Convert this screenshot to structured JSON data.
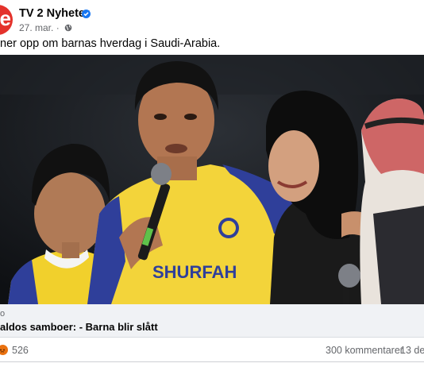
{
  "post": {
    "page_name": "TV 2 Nyheter",
    "date": "27. mar.",
    "audience_icon": "globe-icon",
    "caption": "ner opp om barnas hverdag i Saudi-Arabia.",
    "image": {
      "jersey_text": "SHURFAH"
    },
    "link": {
      "domain": "o",
      "title": "aldos samboer: - Barna blir slått"
    },
    "reactions": {
      "icon": "angry-reaction-icon",
      "count": "526",
      "comments": "300 kommentarer",
      "shares": "13 del"
    }
  },
  "colors": {
    "brand": "#e4322b",
    "verified": "#1877f2",
    "jersey_yellow": "#f3d43a",
    "jersey_blue": "#2f3f9a"
  }
}
